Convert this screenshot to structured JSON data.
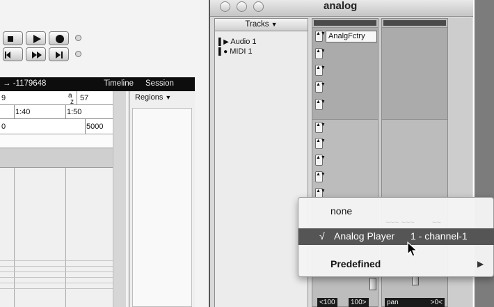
{
  "left_window": {
    "counter": "→ -1179648",
    "view_tabs": [
      "Timeline",
      "Session"
    ],
    "ruler_rows": [
      {
        "cells": [
          "9",
          "57"
        ]
      },
      {
        "cells": [
          "1:40",
          "1:50"
        ]
      },
      {
        "cells": [
          "0",
          "5000"
        ]
      }
    ],
    "regions_label": "Regions",
    "sort_label": "a",
    "sort_label2": "z"
  },
  "analog_window": {
    "title": "analog",
    "tracks_label": "Tracks",
    "tracks": [
      {
        "name": "Audio 1",
        "icon": "audio-track-icon"
      },
      {
        "name": "MIDI 1",
        "icon": "midi-track-icon"
      }
    ],
    "plugin_slot": "AnalgFctry",
    "bottom_fields": [
      "<100",
      "100>",
      "pan",
      ">0<"
    ]
  },
  "popup_menu": {
    "items": [
      {
        "label": "none",
        "checked": false,
        "submenu": false
      },
      {
        "label": "Analog Player",
        "extra": "1 - channel-1",
        "checked": true,
        "submenu": false
      },
      {
        "label": "Predefined",
        "checked": false,
        "submenu": true
      }
    ],
    "checkmark": "√",
    "submenu_arrow": "▶"
  },
  "colors": {
    "menu_highlight": "#555555",
    "counter_bar": "#0d0d0d"
  }
}
